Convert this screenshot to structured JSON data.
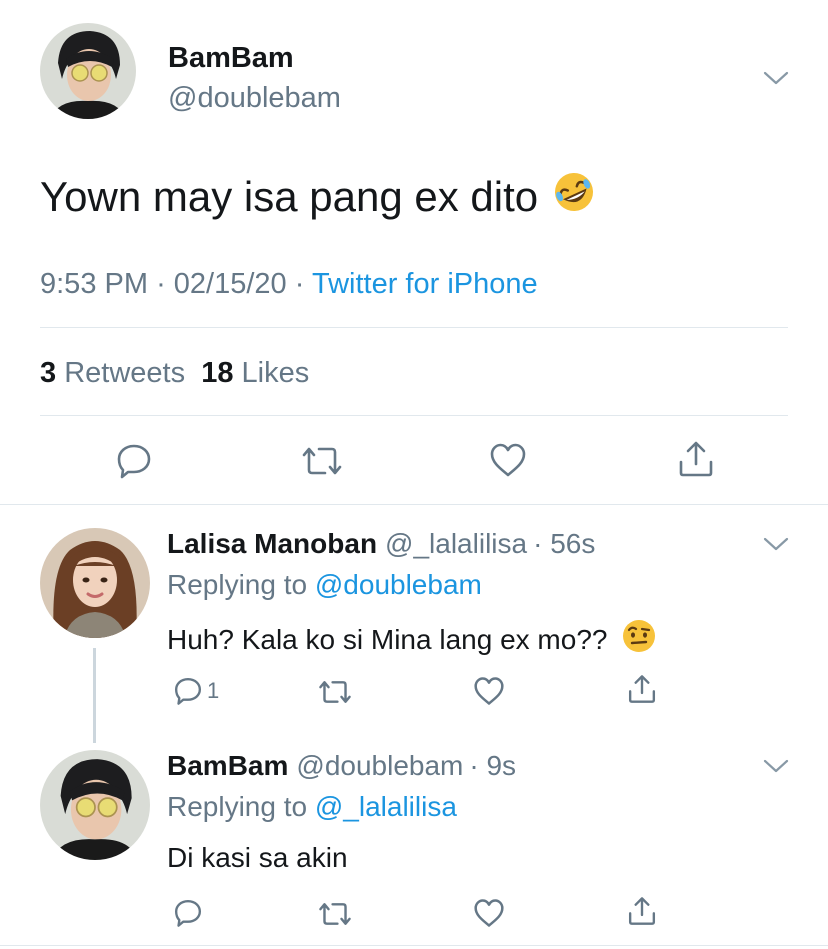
{
  "main_tweet": {
    "name": "BamBam",
    "handle": "@doublebam",
    "text": "Yown may isa pang ex dito",
    "emoji": "rolling-on-floor-laughing-emoji",
    "time": "9:53 PM",
    "date": "02/15/20",
    "separator": "·",
    "source": "Twitter for iPhone",
    "retweets_count": "3",
    "retweets_label": "Retweets",
    "likes_count": "18",
    "likes_label": "Likes"
  },
  "replies": [
    {
      "name": "Lalisa Manoban",
      "handle": "@_lalalilisa",
      "time": "· 56s",
      "replying_prefix": "Replying to",
      "replying_to": "@doublebam",
      "text": "Huh? Kala ko si Mina lang ex mo??",
      "emoji": "face-with-raised-eyebrow-emoji",
      "reply_count": "1"
    },
    {
      "name": "BamBam",
      "handle": "@doublebam",
      "time": "· 9s",
      "replying_prefix": "Replying to",
      "replying_to": "@_lalalilisa",
      "text": "Di kasi sa akin",
      "reply_count": ""
    }
  ],
  "colors": {
    "text": "#14171a",
    "secondary": "#657786",
    "link": "#1b95e0",
    "divider": "#e1e8ed"
  }
}
